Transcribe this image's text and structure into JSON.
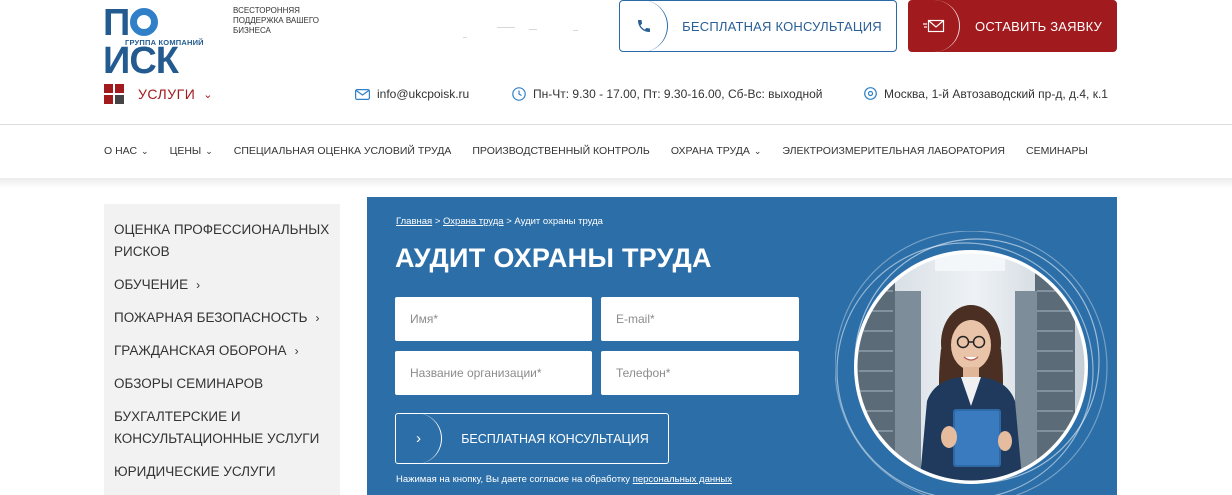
{
  "logo": {
    "word": "ПОИСК",
    "sub": "ГРУППА КОМПАНИЙ",
    "tagline": "ВСЕСТОРОННЯЯ ПОДДЕРЖКА ВАШЕГО БИЗНЕСА"
  },
  "header": {
    "consult_label": "БЕСПЛАТНАЯ КОНСУЛЬТАЦИЯ",
    "order_label": "ОСТАВИТЬ ЗАЯВКУ"
  },
  "infobar": {
    "services_label": "УСЛУГИ",
    "email": "info@ukcpoisk.ru",
    "hours": "Пн-Чт: 9.30 - 17.00, Пт: 9.30-16.00, Сб-Вс: выходной",
    "address": "Москва, 1-й Автозаводский пр-д, д.4, к.1"
  },
  "nav": [
    {
      "label": "О НАС",
      "dropdown": true
    },
    {
      "label": "ЦЕНЫ",
      "dropdown": true
    },
    {
      "label": "СПЕЦИАЛЬНАЯ ОЦЕНКА УСЛОВИЙ ТРУДА",
      "dropdown": false
    },
    {
      "label": "ПРОИЗВОДСТВЕННЫЙ КОНТРОЛЬ",
      "dropdown": false
    },
    {
      "label": "ОХРАНА ТРУДА",
      "dropdown": true
    },
    {
      "label": "ЭЛЕКТРОИЗМЕРИТЕЛЬНАЯ ЛАБОРАТОРИЯ",
      "dropdown": false
    },
    {
      "label": "СЕМИНАРЫ",
      "dropdown": false
    }
  ],
  "sidebar": [
    {
      "label": "ОЦЕНКА ПРОФЕССИОНАЛЬНЫХ РИСКОВ",
      "arrow": false
    },
    {
      "label": "ОБУЧЕНИЕ",
      "arrow": true
    },
    {
      "label": "ПОЖАРНАЯ БЕЗОПАСНОСТЬ",
      "arrow": true
    },
    {
      "label": "ГРАЖДАНСКАЯ ОБОРОНА",
      "arrow": true
    },
    {
      "label": "ОБЗОРЫ СЕМИНАРОВ",
      "arrow": false
    },
    {
      "label": "БУХГАЛТЕРСКИЕ И КОНСУЛЬТАЦИОННЫЕ УСЛУГИ",
      "arrow": false
    },
    {
      "label": "ЮРИДИЧЕСКИЕ УСЛУГИ",
      "arrow": false
    }
  ],
  "hero": {
    "breadcrumb": [
      {
        "label": "Главная",
        "link": true
      },
      {
        "label": "Охрана труда",
        "link": true
      },
      {
        "label": "Аудит охраны труда",
        "link": false
      }
    ],
    "breadcrumb_sep": ">",
    "title": "АУДИТ ОХРАНЫ ТРУДА",
    "form": {
      "name_placeholder": "Имя*",
      "email_placeholder": "E-mail*",
      "org_placeholder": "Название организации*",
      "phone_placeholder": "Телефон*"
    },
    "button_label": "БЕСПЛАТНАЯ КОНСУЛЬТАЦИЯ",
    "consent_text": "Нажимая на кнопку, Вы даете согласие на обработку ",
    "consent_link": "персональных данных"
  },
  "colors": {
    "brand_blue": "#2b6ea8",
    "brand_red": "#a01a1e",
    "logo_blue": "#235a8f"
  },
  "icons": {
    "consult": "phone-icon",
    "order": "envelope-icon",
    "services": "grid-squares-icon",
    "email": "mail-icon",
    "hours": "clock-icon",
    "address": "location-pin-icon",
    "hero_button": "chevron-right-icon"
  }
}
